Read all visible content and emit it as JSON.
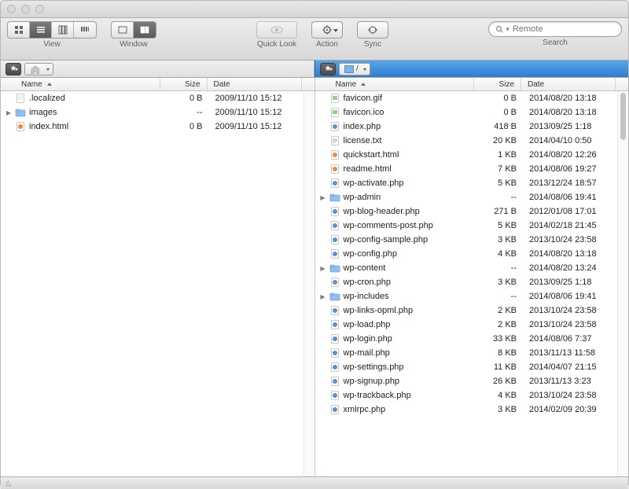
{
  "toolbar": {
    "view_label": "View",
    "window_label": "Window",
    "quicklook_label": "Quick Look",
    "action_label": "Action",
    "sync_label": "Sync",
    "search_label": "Search",
    "search_placeholder": "Remote"
  },
  "pathbar": {
    "left_crumb": "",
    "right_crumb": "/"
  },
  "columns": {
    "name": "Name",
    "size": "Size",
    "date": "Date"
  },
  "left_files": [
    {
      "name": ".localized",
      "size": "0 B",
      "date": "2009/11/10 15:12",
      "kind": "file",
      "expandable": false
    },
    {
      "name": "images",
      "size": "--",
      "date": "2009/11/10 15:12",
      "kind": "folder",
      "expandable": true
    },
    {
      "name": "index.html",
      "size": "0 B",
      "date": "2009/11/10 15:12",
      "kind": "html",
      "expandable": false
    }
  ],
  "right_files": [
    {
      "name": "favicon.gif",
      "size": "0 B",
      "date": "2014/08/20 13:18",
      "kind": "image",
      "expandable": false
    },
    {
      "name": "favicon.ico",
      "size": "0 B",
      "date": "2014/08/20 13:18",
      "kind": "image",
      "expandable": false
    },
    {
      "name": "index.php",
      "size": "418 B",
      "date": "2013/09/25 1:18",
      "kind": "php",
      "expandable": false
    },
    {
      "name": "license.txt",
      "size": "20 KB",
      "date": "2014/04/10 0:50",
      "kind": "txt",
      "expandable": false
    },
    {
      "name": "quickstart.html",
      "size": "1 KB",
      "date": "2014/08/20 12:26",
      "kind": "html",
      "expandable": false
    },
    {
      "name": "readme.html",
      "size": "7 KB",
      "date": "2014/08/06 19:27",
      "kind": "html",
      "expandable": false
    },
    {
      "name": "wp-activate.php",
      "size": "5 KB",
      "date": "2013/12/24 18:57",
      "kind": "php",
      "expandable": false
    },
    {
      "name": "wp-admin",
      "size": "--",
      "date": "2014/08/06 19:41",
      "kind": "folder",
      "expandable": true
    },
    {
      "name": "wp-blog-header.php",
      "size": "271 B",
      "date": "2012/01/08 17:01",
      "kind": "php",
      "expandable": false
    },
    {
      "name": "wp-comments-post.php",
      "size": "5 KB",
      "date": "2014/02/18 21:45",
      "kind": "php",
      "expandable": false
    },
    {
      "name": "wp-config-sample.php",
      "size": "3 KB",
      "date": "2013/10/24 23:58",
      "kind": "php",
      "expandable": false
    },
    {
      "name": "wp-config.php",
      "size": "4 KB",
      "date": "2014/08/20 13:18",
      "kind": "php",
      "expandable": false
    },
    {
      "name": "wp-content",
      "size": "--",
      "date": "2014/08/20 13:24",
      "kind": "folder",
      "expandable": true
    },
    {
      "name": "wp-cron.php",
      "size": "3 KB",
      "date": "2013/09/25 1:18",
      "kind": "php",
      "expandable": false
    },
    {
      "name": "wp-includes",
      "size": "--",
      "date": "2014/08/06 19:41",
      "kind": "folder",
      "expandable": true
    },
    {
      "name": "wp-links-opml.php",
      "size": "2 KB",
      "date": "2013/10/24 23:58",
      "kind": "php",
      "expandable": false
    },
    {
      "name": "wp-load.php",
      "size": "2 KB",
      "date": "2013/10/24 23:58",
      "kind": "php",
      "expandable": false
    },
    {
      "name": "wp-login.php",
      "size": "33 KB",
      "date": "2014/08/06 7:37",
      "kind": "php",
      "expandable": false
    },
    {
      "name": "wp-mail.php",
      "size": "8 KB",
      "date": "2013/11/13 11:58",
      "kind": "php",
      "expandable": false
    },
    {
      "name": "wp-settings.php",
      "size": "11 KB",
      "date": "2014/04/07 21:15",
      "kind": "php",
      "expandable": false
    },
    {
      "name": "wp-signup.php",
      "size": "26 KB",
      "date": "2013/11/13 3:23",
      "kind": "php",
      "expandable": false
    },
    {
      "name": "wp-trackback.php",
      "size": "4 KB",
      "date": "2013/10/24 23:58",
      "kind": "php",
      "expandable": false
    },
    {
      "name": "xmlrpc.php",
      "size": "3 KB",
      "date": "2014/02/09 20:39",
      "kind": "php",
      "expandable": false
    }
  ]
}
